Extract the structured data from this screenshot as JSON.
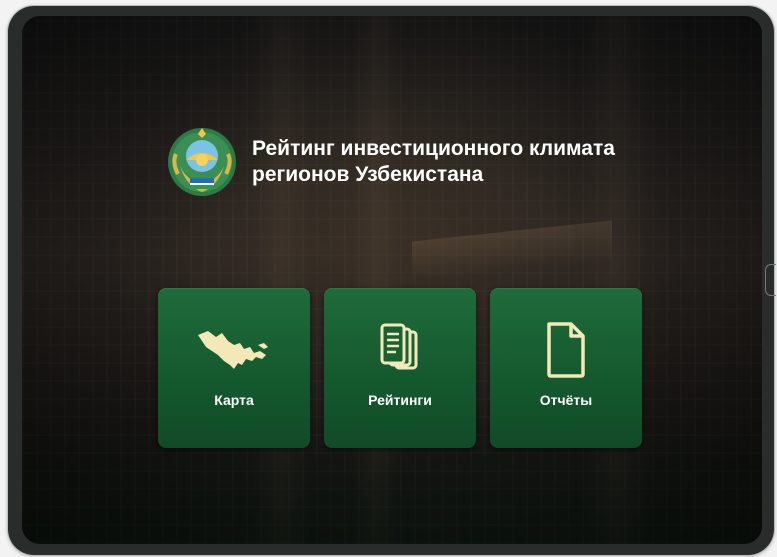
{
  "app": {
    "title": "Рейтинг инвестиционного климата регионов Узбекистана"
  },
  "header": {
    "emblem_icon": "uzbekistan-state-emblem",
    "title": "Рейтинг инвестиционного климата регионов Узбекистана"
  },
  "tiles": [
    {
      "label": "Карта",
      "icon": "uzbekistan-map-icon"
    },
    {
      "label": "Рейтинги",
      "icon": "documents-stack-icon"
    },
    {
      "label": "Отчёты",
      "icon": "document-icon"
    }
  ],
  "colors": {
    "tile_green": "#1a6334",
    "icon_cream": "#f3e9b8",
    "title_text": "#ffffff"
  }
}
